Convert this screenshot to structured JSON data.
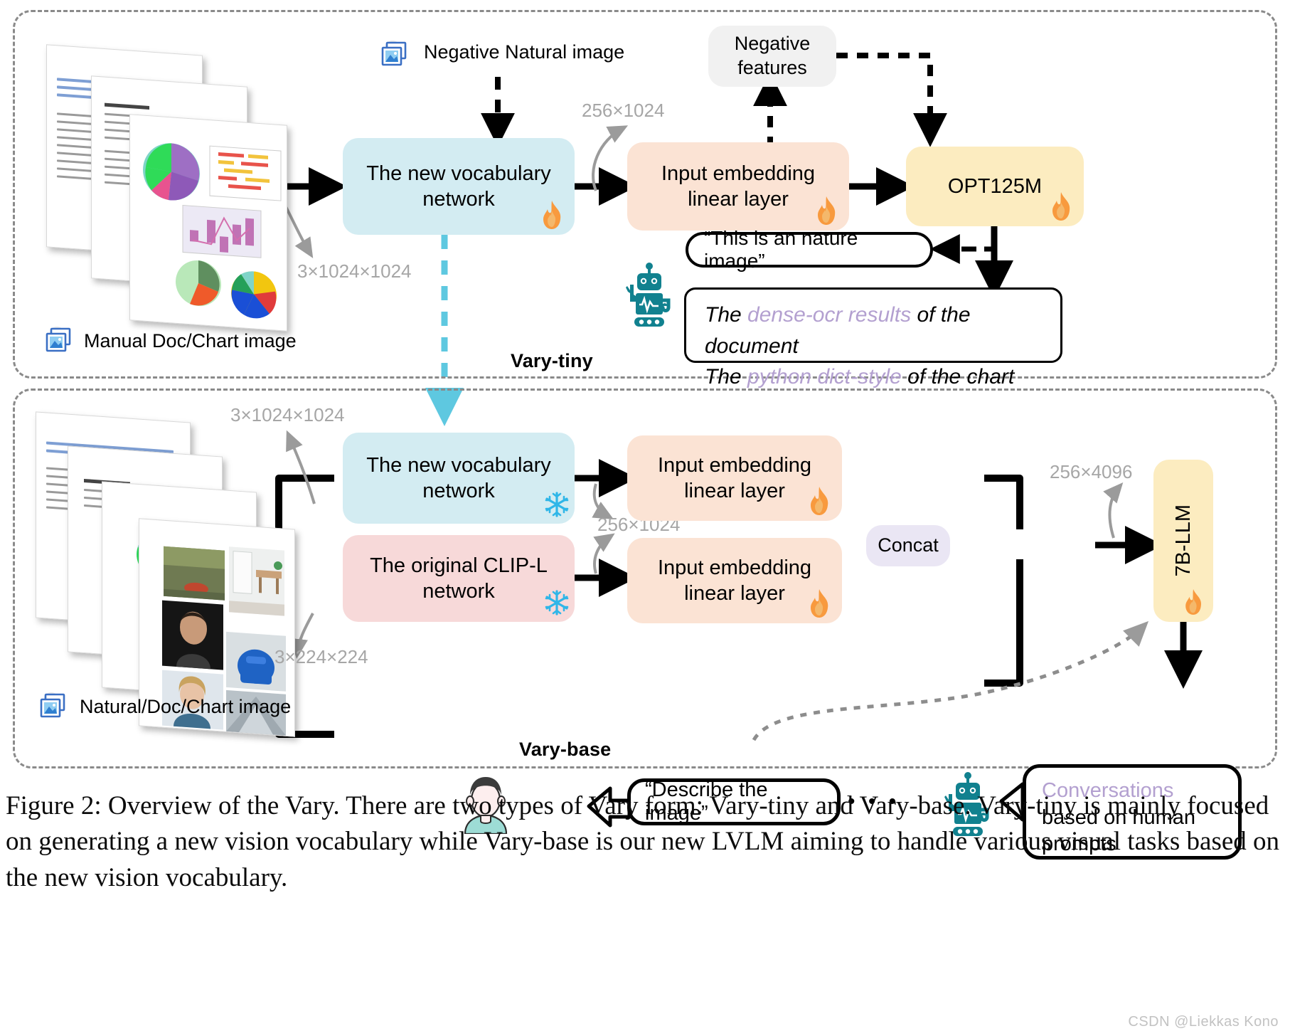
{
  "figure": {
    "caption": "Figure 2: Overview of the Vary. There are two types of Vary form: Vary-tiny and Vary-base. Vary-tiny is mainly focused on generating a new vision vocabulary while Vary-base is our new LVLM aiming to handle various visual tasks based on the new vision vocabulary.",
    "watermark": "CSDN @Liekkas Kono"
  },
  "panels": {
    "tiny_label": "Vary-tiny",
    "base_label": "Vary-base"
  },
  "tiny": {
    "input_label": "Manual Doc/Chart image",
    "negative_input_label": "Negative Natural image",
    "vocab_box": "The new vocabulary network",
    "embed_box": "Input embedding linear layer",
    "llm_box": "OPT125M",
    "negative_features_box": "Negative features",
    "dim_input": "3×1024×1024",
    "dim_tokens": "256×1024",
    "speech_negative": "“This is an nature image”",
    "output_line1_pre": "The ",
    "output_line1_hl": "dense-ocr results",
    "output_line1_post": " of the document",
    "output_line2_pre": "The ",
    "output_line2_hl": "python dict-style",
    "output_line2_post": " of the chart"
  },
  "base": {
    "input_label": "Natural/Doc/Chart image",
    "vocab_box": "The new vocabulary network",
    "clip_box": "The original CLIP-L network",
    "embed_box_top": "Input embedding linear layer",
    "embed_box_bottom": "Input embedding linear layer",
    "concat_box": "Concat",
    "llm_box": "7B-LLM",
    "dim_vocab_in": "3×1024×1024",
    "dim_clip_in": "3×224×224",
    "dim_tokens": "256×1024",
    "dim_concat": "256×4096",
    "prompt_text": "“Describe the image”",
    "prompt_ellipsis": "• • •",
    "answer_hl": "Conversations",
    "answer_rest_line1": "based on human",
    "answer_rest_line2": "prompts"
  },
  "icons": {
    "fire": "fire-icon",
    "snowflake": "snowflake-icon",
    "robot": "robot-icon",
    "person": "person-icon",
    "image": "image-stack-icon"
  },
  "colors": {
    "blue_box": "#d3ecf2",
    "peach_box": "#fbe3d4",
    "yellow_box": "#fcecc0",
    "pink_box": "#f7d9d9",
    "grey_box": "#f1f1f1",
    "lilac_box": "#eae6f4",
    "highlight_text": "#b3a0d0",
    "dim_text": "#a6a6a6",
    "teal_robot": "#11818f",
    "cyan_dashed": "#5ec8e0",
    "fire_orange": "#f89a3e",
    "snow_blue": "#2fb6e8"
  }
}
